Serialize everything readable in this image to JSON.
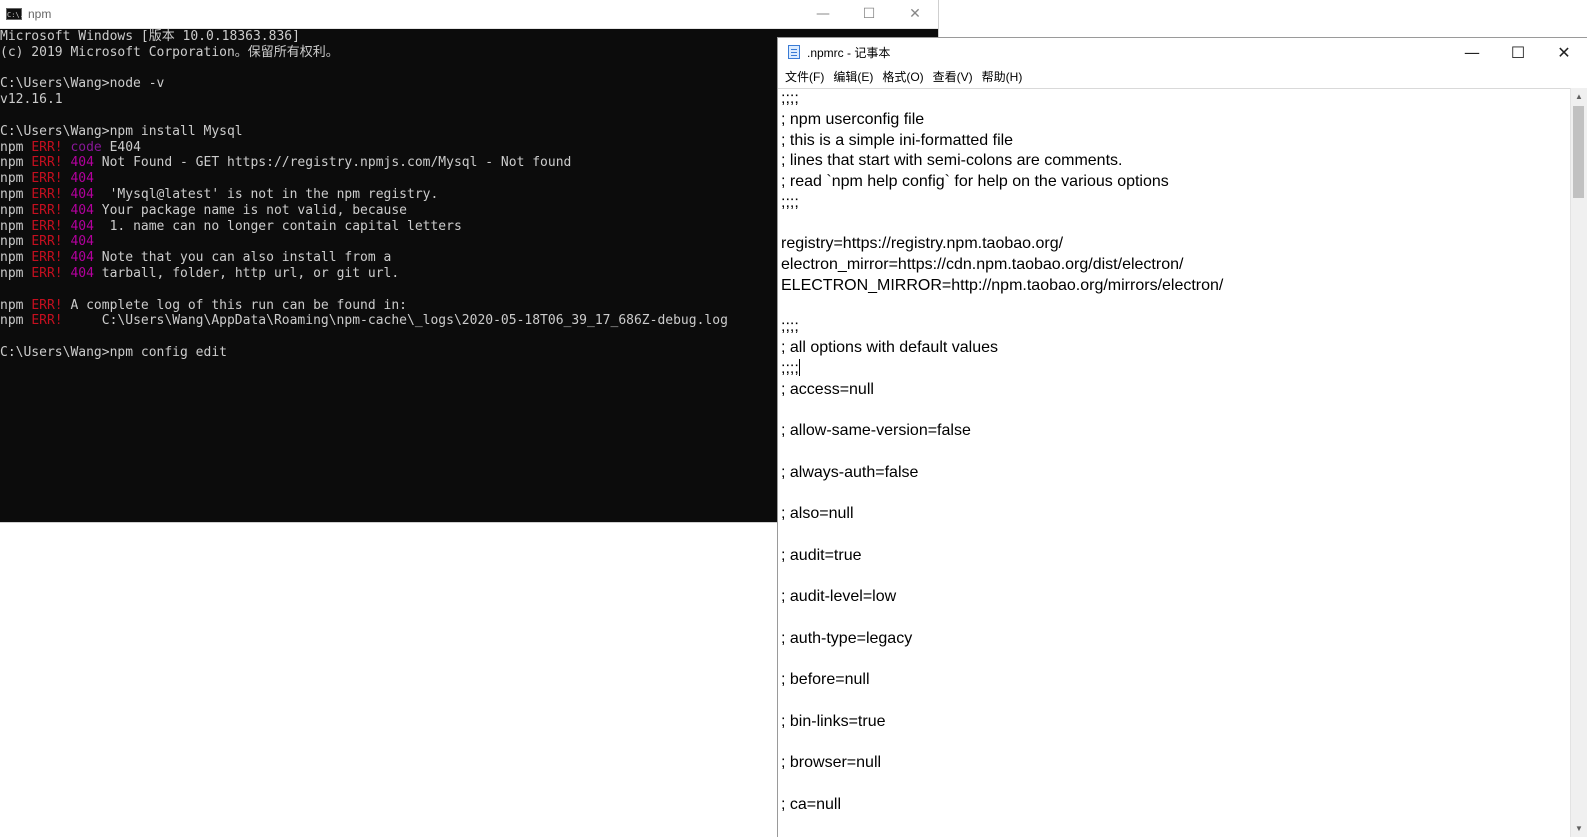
{
  "terminal": {
    "title": "npm",
    "icon_text": "C:\\.",
    "lines": [
      [
        {
          "t": "Microsoft Windows [版本 10.0.18363.836]"
        }
      ],
      [
        {
          "t": "(c) 2019 Microsoft Corporation。保留所有权利。"
        }
      ],
      [
        {
          "t": ""
        }
      ],
      [
        {
          "t": "C:\\Users\\Wang>node -v"
        }
      ],
      [
        {
          "t": "v12.16.1"
        }
      ],
      [
        {
          "t": ""
        }
      ],
      [
        {
          "t": "C:\\Users\\Wang>npm install Mysql"
        }
      ],
      [
        {
          "t": "npm "
        },
        {
          "t": "ERR!",
          "c": "err"
        },
        {
          "t": " "
        },
        {
          "t": "code",
          "c": "code"
        },
        {
          "t": " E404"
        }
      ],
      [
        {
          "t": "npm "
        },
        {
          "t": "ERR!",
          "c": "err"
        },
        {
          "t": " "
        },
        {
          "t": "404",
          "c": "404"
        },
        {
          "t": " Not Found - GET https://registry.npmjs.com/Mysql - Not found"
        }
      ],
      [
        {
          "t": "npm "
        },
        {
          "t": "ERR!",
          "c": "err"
        },
        {
          "t": " "
        },
        {
          "t": "404",
          "c": "404"
        }
      ],
      [
        {
          "t": "npm "
        },
        {
          "t": "ERR!",
          "c": "err"
        },
        {
          "t": " "
        },
        {
          "t": "404",
          "c": "404"
        },
        {
          "t": "  'Mysql@latest' is not in the npm registry."
        }
      ],
      [
        {
          "t": "npm "
        },
        {
          "t": "ERR!",
          "c": "err"
        },
        {
          "t": " "
        },
        {
          "t": "404",
          "c": "404"
        },
        {
          "t": " Your package name is not valid, because"
        }
      ],
      [
        {
          "t": "npm "
        },
        {
          "t": "ERR!",
          "c": "err"
        },
        {
          "t": " "
        },
        {
          "t": "404",
          "c": "404"
        },
        {
          "t": "  1. name can no longer contain capital letters"
        }
      ],
      [
        {
          "t": "npm "
        },
        {
          "t": "ERR!",
          "c": "err"
        },
        {
          "t": " "
        },
        {
          "t": "404",
          "c": "404"
        }
      ],
      [
        {
          "t": "npm "
        },
        {
          "t": "ERR!",
          "c": "err"
        },
        {
          "t": " "
        },
        {
          "t": "404",
          "c": "404"
        },
        {
          "t": " Note that you can also install from a"
        }
      ],
      [
        {
          "t": "npm "
        },
        {
          "t": "ERR!",
          "c": "err"
        },
        {
          "t": " "
        },
        {
          "t": "404",
          "c": "404"
        },
        {
          "t": " tarball, folder, http url, or git url."
        }
      ],
      [
        {
          "t": ""
        }
      ],
      [
        {
          "t": "npm "
        },
        {
          "t": "ERR!",
          "c": "err"
        },
        {
          "t": " A complete log of this run can be found in:"
        }
      ],
      [
        {
          "t": "npm "
        },
        {
          "t": "ERR!",
          "c": "err"
        },
        {
          "t": "     C:\\Users\\Wang\\AppData\\Roaming\\npm-cache\\_logs\\2020-05-18T06_39_17_686Z-debug.log"
        }
      ],
      [
        {
          "t": ""
        }
      ],
      [
        {
          "t": "C:\\Users\\Wang>npm config edit"
        }
      ]
    ]
  },
  "notepad": {
    "title": ".npmrc - 记事本",
    "menu": [
      "文件(F)",
      "编辑(E)",
      "格式(O)",
      "查看(V)",
      "帮助(H)"
    ],
    "caret_line": 13,
    "lines": [
      ";;;;",
      "; npm userconfig file",
      "; this is a simple ini-formatted file",
      "; lines that start with semi-colons are comments.",
      "; read `npm help config` for help on the various options",
      ";;;;",
      "",
      "registry=https://registry.npm.taobao.org/",
      "electron_mirror=https://cdn.npm.taobao.org/dist/electron/",
      "ELECTRON_MIRROR=http://npm.taobao.org/mirrors/electron/",
      "",
      ";;;;",
      "; all options with default values",
      ";;;;",
      "; access=null",
      "",
      "; allow-same-version=false",
      "",
      "; always-auth=false",
      "",
      "; also=null",
      "",
      "; audit=true",
      "",
      "; audit-level=low",
      "",
      "; auth-type=legacy",
      "",
      "; before=null",
      "",
      "; bin-links=true",
      "",
      "; browser=null",
      "",
      "; ca=null"
    ]
  },
  "window_controls": {
    "minimize": "—",
    "maximize": "☐",
    "close": "✕"
  }
}
